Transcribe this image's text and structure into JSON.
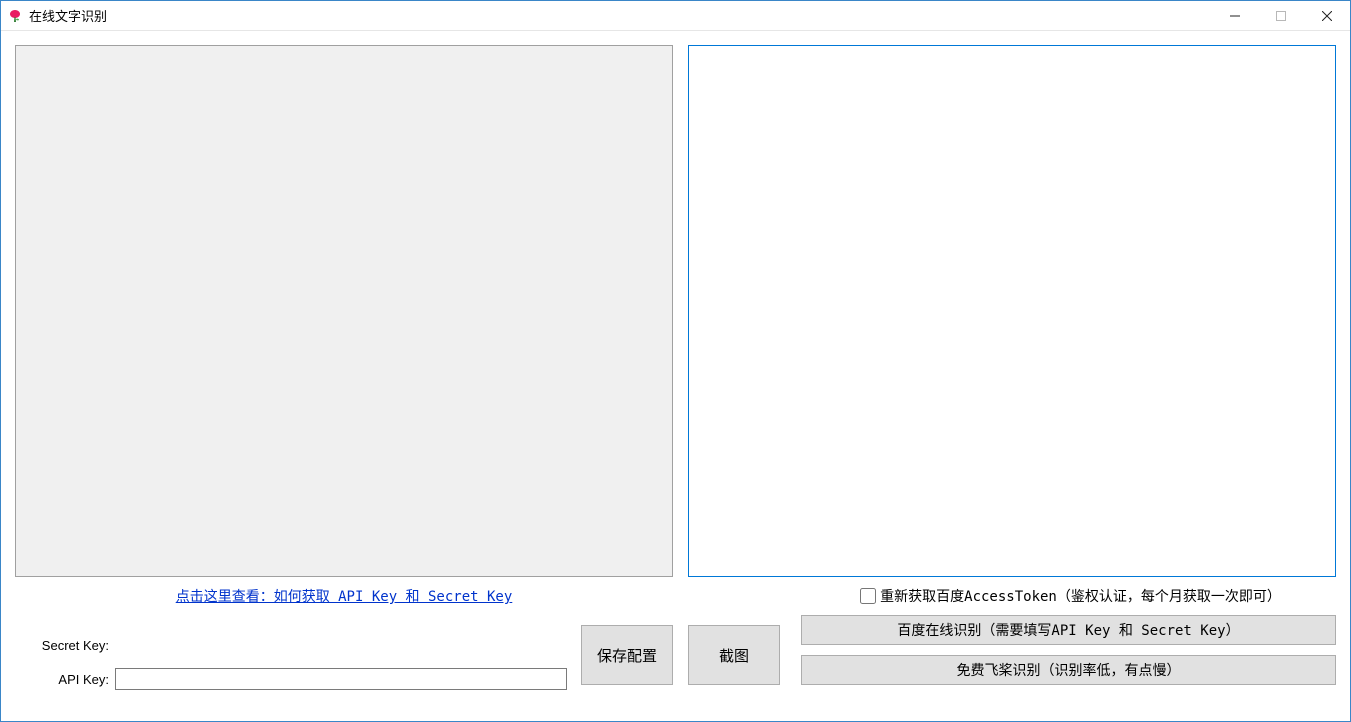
{
  "window": {
    "title": "在线文字识别"
  },
  "left": {
    "help_link_text": "点击这里查看：如何获取 API Key 和 Secret Key",
    "secret_key_label": "Secret Key:",
    "api_key_label": "API Key:",
    "secret_key_value": "",
    "api_key_value": "",
    "save_button": "保存配置",
    "screenshot_button": "截图"
  },
  "right": {
    "output_text": "",
    "checkbox_label": "重新获取百度AccessToken（鉴权认证，每个月获取一次即可）",
    "checkbox_checked": false,
    "baidu_button": "百度在线识别（需要填写API Key 和 Secret Key）",
    "paddle_button": "免费飞桨识别（识别率低，有点慢）"
  }
}
